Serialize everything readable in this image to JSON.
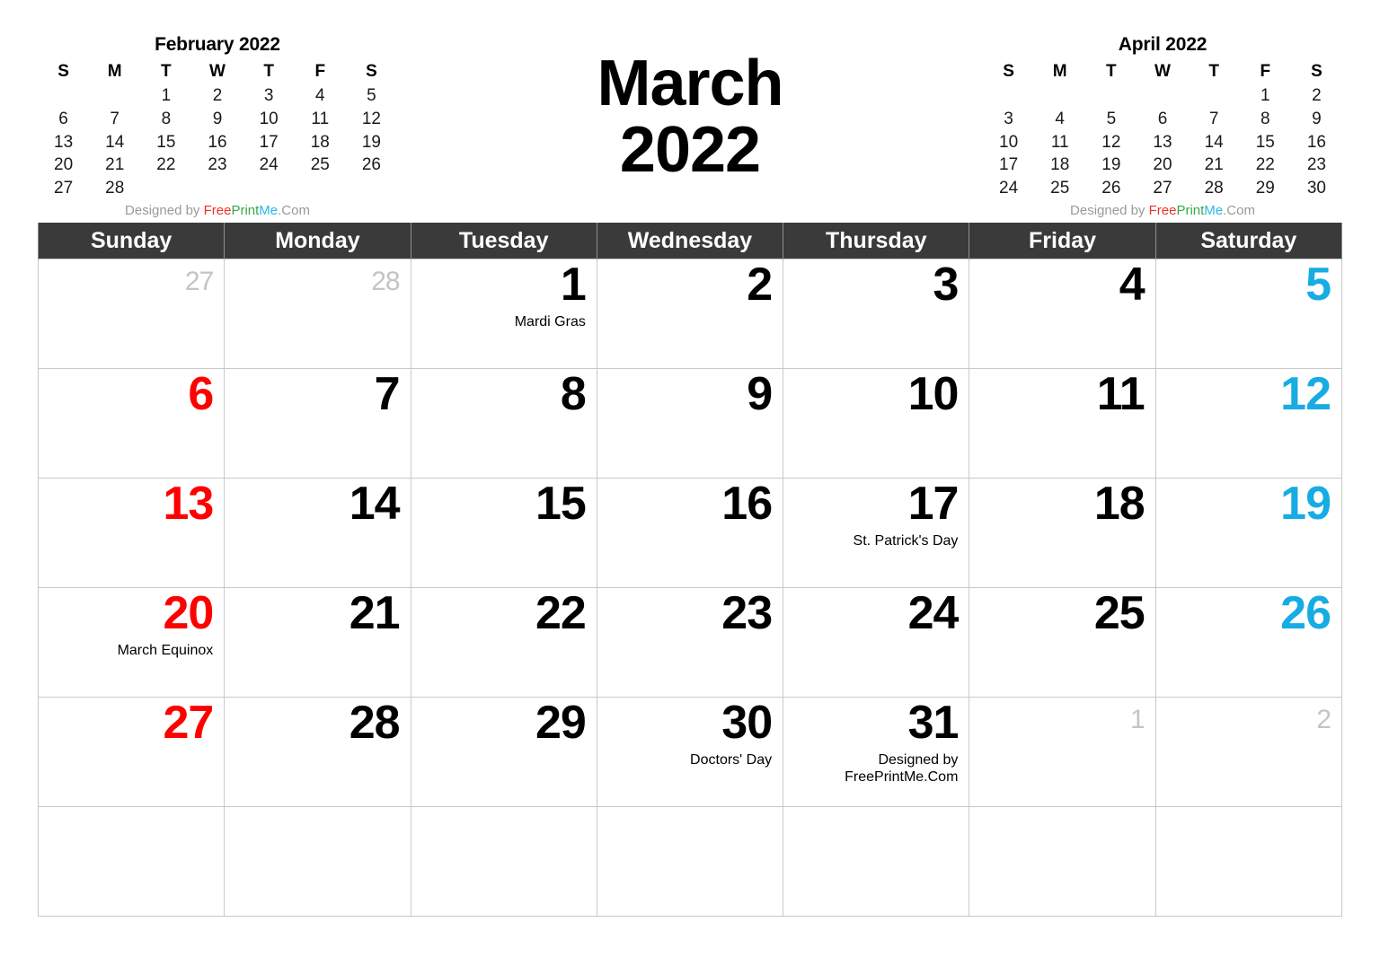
{
  "header": {
    "month_name": "March",
    "year": "2022"
  },
  "credit": {
    "prefix": "Designed by ",
    "free": "Free",
    "print": "Print",
    "me": "Me",
    "com": ".Com",
    "full": "Designed by FreePrintMe.Com",
    "line1": "Designed by",
    "line2": "FreePrintMe.Com"
  },
  "mini_prev": {
    "title": "February 2022",
    "weekdays": [
      "S",
      "M",
      "T",
      "W",
      "T",
      "F",
      "S"
    ],
    "weeks": [
      [
        "",
        "",
        "1",
        "2",
        "3",
        "4",
        "5"
      ],
      [
        "6",
        "7",
        "8",
        "9",
        "10",
        "11",
        "12"
      ],
      [
        "13",
        "14",
        "15",
        "16",
        "17",
        "18",
        "19"
      ],
      [
        "20",
        "21",
        "22",
        "23",
        "24",
        "25",
        "26"
      ],
      [
        "27",
        "28",
        "",
        "",
        "",
        "",
        ""
      ]
    ]
  },
  "mini_next": {
    "title": "April 2022",
    "weekdays": [
      "S",
      "M",
      "T",
      "W",
      "T",
      "F",
      "S"
    ],
    "weeks": [
      [
        "",
        "",
        "",
        "",
        "",
        "1",
        "2"
      ],
      [
        "3",
        "4",
        "5",
        "6",
        "7",
        "8",
        "9"
      ],
      [
        "10",
        "11",
        "12",
        "13",
        "14",
        "15",
        "16"
      ],
      [
        "17",
        "18",
        "19",
        "20",
        "21",
        "22",
        "23"
      ],
      [
        "24",
        "25",
        "26",
        "27",
        "28",
        "29",
        "30"
      ]
    ]
  },
  "main": {
    "weekday_headers": [
      "Sunday",
      "Monday",
      "Tuesday",
      "Wednesday",
      "Thursday",
      "Friday",
      "Saturday"
    ],
    "colors": {
      "sunday": "#FF0000",
      "saturday": "#17ACE3",
      "weekday": "#000000",
      "outside_month": "#C4C4C4",
      "header_background": "#3A3A3A",
      "header_text": "#FFFFFF",
      "grid_line": "#C9C9C9"
    },
    "weeks": [
      [
        {
          "num": "27",
          "type": "out",
          "event": ""
        },
        {
          "num": "28",
          "type": "out",
          "event": ""
        },
        {
          "num": "1",
          "type": "wd",
          "event": "Mardi Gras"
        },
        {
          "num": "2",
          "type": "wd",
          "event": ""
        },
        {
          "num": "3",
          "type": "wd",
          "event": ""
        },
        {
          "num": "4",
          "type": "wd",
          "event": ""
        },
        {
          "num": "5",
          "type": "sat",
          "event": ""
        }
      ],
      [
        {
          "num": "6",
          "type": "sun",
          "event": ""
        },
        {
          "num": "7",
          "type": "wd",
          "event": ""
        },
        {
          "num": "8",
          "type": "wd",
          "event": ""
        },
        {
          "num": "9",
          "type": "wd",
          "event": ""
        },
        {
          "num": "10",
          "type": "wd",
          "event": ""
        },
        {
          "num": "11",
          "type": "wd",
          "event": ""
        },
        {
          "num": "12",
          "type": "sat",
          "event": ""
        }
      ],
      [
        {
          "num": "13",
          "type": "sun",
          "event": ""
        },
        {
          "num": "14",
          "type": "wd",
          "event": ""
        },
        {
          "num": "15",
          "type": "wd",
          "event": ""
        },
        {
          "num": "16",
          "type": "wd",
          "event": ""
        },
        {
          "num": "17",
          "type": "wd",
          "event": "St. Patrick's Day"
        },
        {
          "num": "18",
          "type": "wd",
          "event": ""
        },
        {
          "num": "19",
          "type": "sat",
          "event": ""
        }
      ],
      [
        {
          "num": "20",
          "type": "sun",
          "event": "March Equinox"
        },
        {
          "num": "21",
          "type": "wd",
          "event": ""
        },
        {
          "num": "22",
          "type": "wd",
          "event": ""
        },
        {
          "num": "23",
          "type": "wd",
          "event": ""
        },
        {
          "num": "24",
          "type": "wd",
          "event": ""
        },
        {
          "num": "25",
          "type": "wd",
          "event": ""
        },
        {
          "num": "26",
          "type": "sat",
          "event": ""
        }
      ],
      [
        {
          "num": "27",
          "type": "sun",
          "event": ""
        },
        {
          "num": "28",
          "type": "wd",
          "event": ""
        },
        {
          "num": "29",
          "type": "wd",
          "event": ""
        },
        {
          "num": "30",
          "type": "wd",
          "event": "Doctors' Day"
        },
        {
          "num": "31",
          "type": "wd",
          "event": "Designed by\nFreePrintMe.Com"
        },
        {
          "num": "1",
          "type": "out",
          "event": ""
        },
        {
          "num": "2",
          "type": "out",
          "event": ""
        }
      ],
      [
        {
          "num": "",
          "type": "wd",
          "event": ""
        },
        {
          "num": "",
          "type": "wd",
          "event": ""
        },
        {
          "num": "",
          "type": "wd",
          "event": ""
        },
        {
          "num": "",
          "type": "wd",
          "event": ""
        },
        {
          "num": "",
          "type": "wd",
          "event": ""
        },
        {
          "num": "",
          "type": "wd",
          "event": ""
        },
        {
          "num": "",
          "type": "wd",
          "event": ""
        }
      ]
    ]
  }
}
